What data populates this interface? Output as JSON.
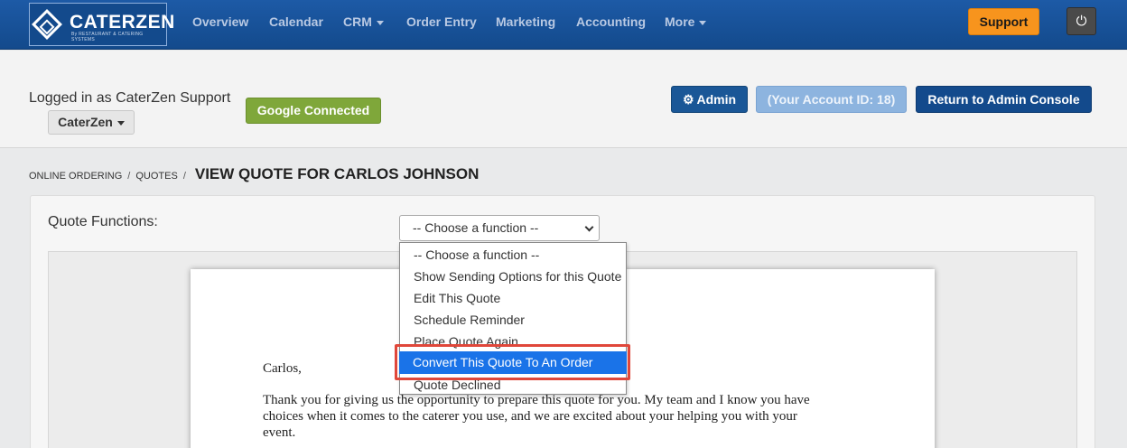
{
  "brand": {
    "name": "CATERZEN",
    "sub": "By RESTAURANT & CATERING SYSTEMS"
  },
  "nav": {
    "items": [
      "Overview",
      "Calendar",
      "CRM",
      "Order Entry",
      "Marketing",
      "Accounting",
      "More"
    ],
    "support_label": "Support",
    "power_glyph": "⏻"
  },
  "account": {
    "logged_in_text": "Logged in as CaterZen Support",
    "company_label": "CaterZen",
    "google_label": "Google Connected",
    "admin_label": "Admin",
    "account_id_label": "(Your Account ID: 18)",
    "return_label": "Return to Admin Console"
  },
  "breadcrumb": {
    "items": [
      "ONLINE ORDERING",
      "QUOTES"
    ],
    "separator": "/",
    "title": "VIEW QUOTE FOR CARLOS JOHNSON"
  },
  "quote": {
    "functions_label": "Quote Functions:",
    "select_value": "-- Choose a function --",
    "options": [
      "-- Choose a function --",
      "Show Sending Options for this Quote",
      "Edit This Quote",
      "Schedule Reminder",
      "Place Quote Again",
      "Convert This Quote To An Order",
      "Quote Declined"
    ],
    "selected_option": "Convert This Quote To An Order"
  },
  "letter": {
    "greeting": "Carlos,",
    "line1": "Thank you for giving us the opportunity to prepare this quote for you. My team and I know you have",
    "line2": "choices when it comes to the caterer you use, and we are excited about your helping you with your",
    "line3": "event."
  },
  "colors": {
    "nav_bg": "#134a8c",
    "support": "#f7941d",
    "google": "#7fa73a",
    "admin": "#1a5797",
    "selected_option": "#1a73e8",
    "highlight": "#e0473a"
  }
}
